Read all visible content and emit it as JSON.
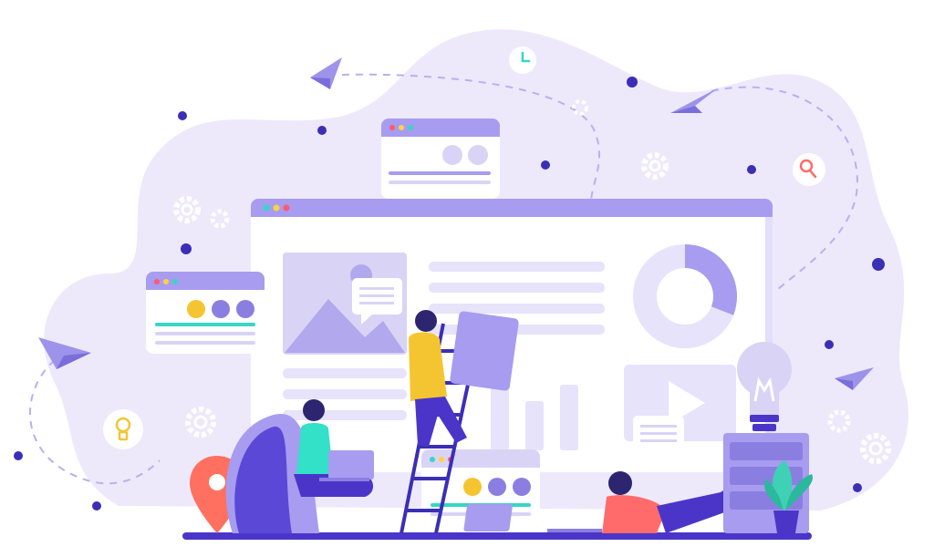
{
  "palette": {
    "background": "#ffffff",
    "blob": "#ede9fb",
    "lavender": "#d9d4f5",
    "purple": "#8a7fe0",
    "deep_purple": "#4b35c9",
    "dark_navy": "#2d2570",
    "browser_bar": "#a79cef",
    "card": "#ffffff",
    "dot_red": "#ff5a6e",
    "dot_yellow": "#ffd23f",
    "dot_teal": "#37d6c5",
    "yellow": "#f5c531",
    "teal": "#33e0c8",
    "coral": "#ff6b6b",
    "pin": "#ff7060",
    "plant": "#3fd1b5",
    "skin": "#2d2570"
  },
  "icons": [
    "paper-plane-icon",
    "clock-icon",
    "search-icon",
    "gear-icon",
    "lightbulb-icon",
    "location-pin-icon",
    "play-icon",
    "donut-chart-icon",
    "image-icon",
    "chat-bubble-icon"
  ]
}
